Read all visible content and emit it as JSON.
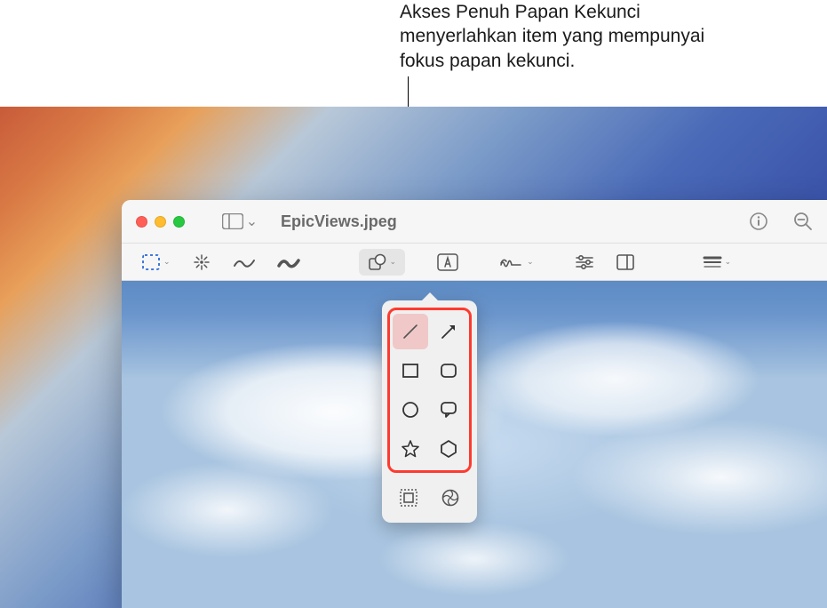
{
  "callout": {
    "text": "Akses Penuh Papan Kekunci menyerlahkan item yang mempunyai fokus papan kekunci."
  },
  "window": {
    "title": "EpicViews.jpeg"
  },
  "toolbar": {
    "selection": "selection-dashed",
    "magic": "instant-alpha",
    "sketch": "sketch",
    "draw": "draw",
    "shapes": "shapes",
    "text": "text",
    "sign": "signature",
    "adjust": "adjust-color",
    "crop": "crop",
    "border": "border-style"
  },
  "shapes_popover": {
    "items": [
      {
        "name": "line",
        "selected": true
      },
      {
        "name": "arrow",
        "selected": false
      },
      {
        "name": "rectangle",
        "selected": false
      },
      {
        "name": "rounded-rectangle",
        "selected": false
      },
      {
        "name": "oval",
        "selected": false
      },
      {
        "name": "speech-bubble",
        "selected": false
      },
      {
        "name": "star",
        "selected": false
      },
      {
        "name": "polygon",
        "selected": false
      }
    ],
    "extras": [
      {
        "name": "mask"
      },
      {
        "name": "loupe"
      }
    ]
  }
}
